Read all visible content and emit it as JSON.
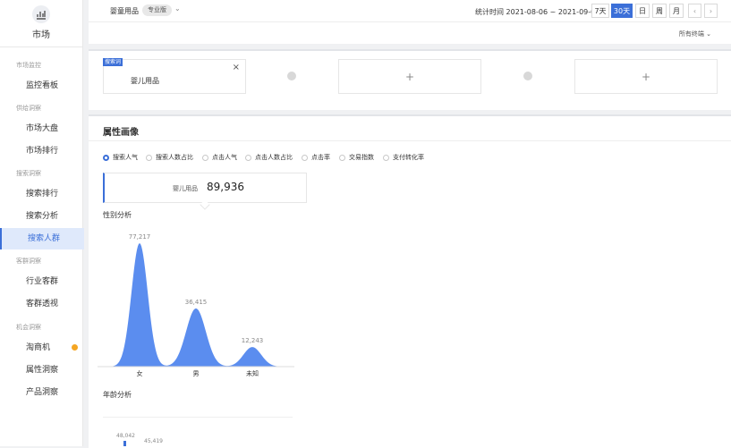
{
  "sidebar": {
    "app_title": "市场",
    "sections": [
      {
        "header": "市场监控",
        "items": [
          {
            "label": "监控看板"
          }
        ]
      },
      {
        "header": "供给洞察",
        "items": [
          {
            "label": "市场大盘"
          },
          {
            "label": "市场排行"
          }
        ]
      },
      {
        "header": "搜索洞察",
        "items": [
          {
            "label": "搜索排行"
          },
          {
            "label": "搜索分析"
          },
          {
            "label": "搜索人群",
            "active": true
          }
        ]
      },
      {
        "header": "客群洞察",
        "items": [
          {
            "label": "行业客群"
          },
          {
            "label": "客群透视"
          }
        ]
      },
      {
        "header": "机会洞察",
        "items": [
          {
            "label": "淘商机",
            "badge": true
          },
          {
            "label": "属性洞察"
          },
          {
            "label": "产品洞察"
          }
        ]
      }
    ]
  },
  "topbar": {
    "category": "婴童用品",
    "version": "专业版",
    "stat_label": "统计时间 2021-08-06 ~ 2021-09-04",
    "ranges": [
      "7天",
      "30天",
      "日",
      "周",
      "月"
    ],
    "active_range": "30天",
    "prev": "‹",
    "next": "›"
  },
  "subbar": {
    "terminal": "所有终端"
  },
  "compare": {
    "card1": {
      "tag": "搜索词",
      "name": "婴儿用品",
      "close": "×"
    },
    "plus": "+"
  },
  "profile": {
    "title": "属性画像",
    "radios": [
      "搜索人气",
      "搜索人数占比",
      "点击人气",
      "点击人数占比",
      "点击率",
      "交易指数",
      "支付转化率"
    ],
    "selected_radio": "搜索人气",
    "metric_label": "婴儿用品",
    "metric_value": "89,936",
    "gender_title": "性别分析",
    "age_title": "年龄分析",
    "age_values": [
      "48,042",
      "45,419"
    ]
  },
  "chart_data": {
    "type": "area",
    "title": "性别分析",
    "categories": [
      "女",
      "男",
      "未知"
    ],
    "values": [
      77217,
      36415,
      12243
    ],
    "data_labels": [
      "77,217",
      "36,415",
      "12,243"
    ],
    "color": "#5b8def"
  },
  "colors": {
    "accent": "#3b6fd8",
    "badge": "#f5a623",
    "chart": "#5b8def"
  },
  "icons": {
    "logo": "chart-icon",
    "close": "close-icon",
    "chevron": "chevron-down-icon"
  }
}
